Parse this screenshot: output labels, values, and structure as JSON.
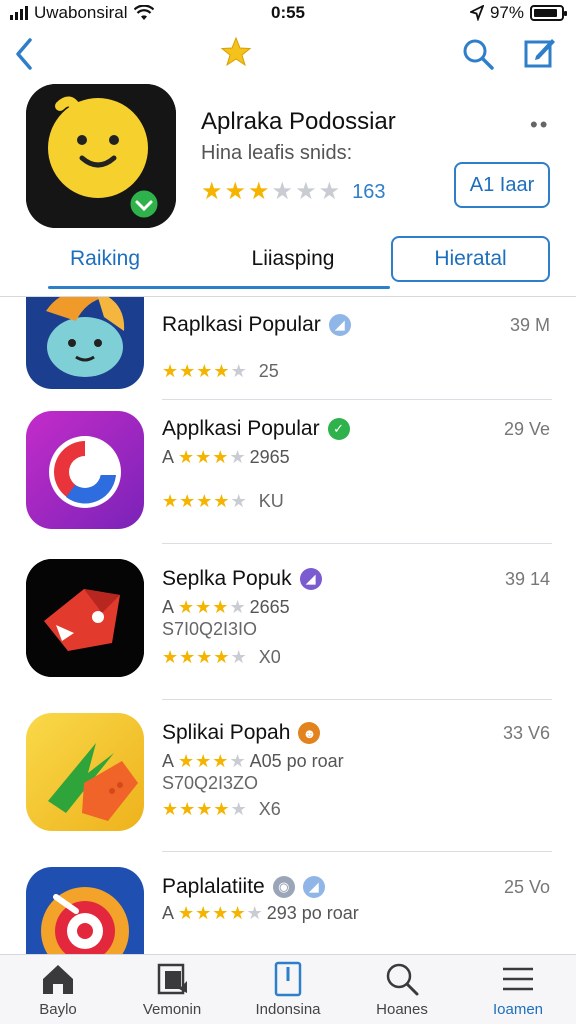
{
  "status_bar": {
    "carrier": "Uwabonsiral",
    "time": "0:55",
    "battery": "97%"
  },
  "nav": {
    "back_icon": "chevron-left-icon",
    "star_icon": "star-icon",
    "search_icon": "search-icon",
    "compose_icon": "compose-icon"
  },
  "app": {
    "title": "Aplraka Podossiar",
    "subtitle": "Hina leafis snids:",
    "rating_count": "163",
    "rating": 2.5,
    "get_label": "A1 Iaar",
    "accent": "#2f7ec9"
  },
  "tabs": [
    {
      "label": "Raiking"
    },
    {
      "label": "Liiasping"
    },
    {
      "label": "Hieratal"
    }
  ],
  "list": [
    {
      "name": "Raplkasi Popular",
      "size": "39 M",
      "line2": "",
      "line3": "",
      "rating_num": "25",
      "stars": 4
    },
    {
      "name": "Applkasi Popular",
      "size": "29 Ve",
      "line2": "A",
      "line2_text": "2965",
      "line3": "",
      "rating_num": "KU",
      "stars": 4
    },
    {
      "name": "Seplka Popuk",
      "size": "39 14",
      "line2": "A",
      "line2_text": "2665",
      "line3": "S7I0Q2I3IO",
      "rating_num": "X0",
      "stars": 4
    },
    {
      "name": "Splikai Popah",
      "size": "33 V6",
      "line2": "A",
      "line2_text": "A05 po roar",
      "line3": "S70Q2I3ZO",
      "rating_num": "X6",
      "stars": 4
    },
    {
      "name": "Paplalatiite",
      "size": "25 Vo",
      "line2": "A",
      "line2_text": "293 po roar",
      "line3": "",
      "rating_num": "",
      "stars": 4
    }
  ],
  "tabbar": [
    {
      "label": "Baylo",
      "icon": "home-icon"
    },
    {
      "label": "Vemonin",
      "icon": "apps-icon"
    },
    {
      "label": "Indonsina",
      "icon": "updates-icon"
    },
    {
      "label": "Hoanes",
      "icon": "search-icon"
    },
    {
      "label": "Ioamen",
      "icon": "menu-icon"
    }
  ]
}
